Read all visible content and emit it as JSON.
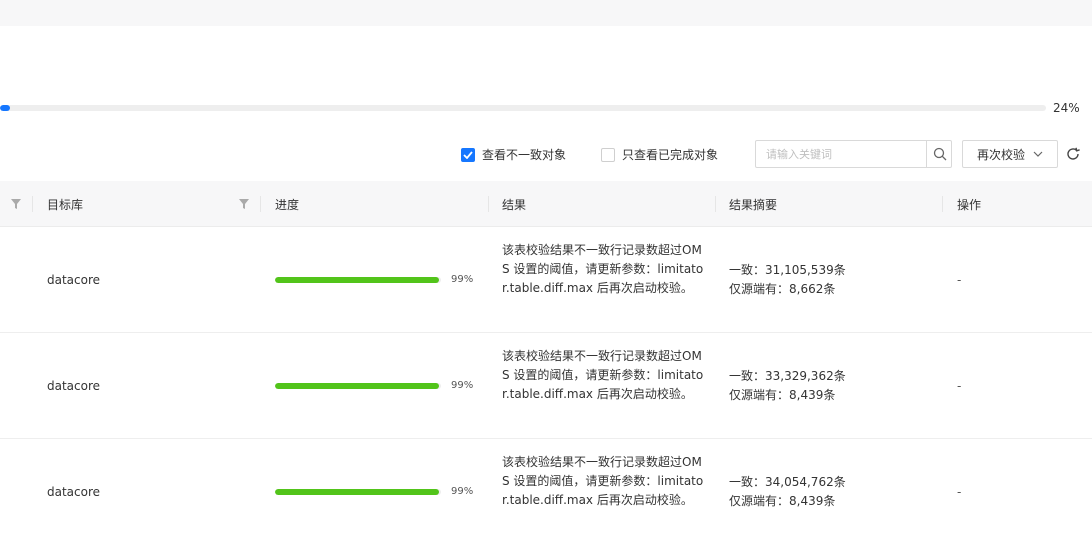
{
  "overall": {
    "percent_label": "24%",
    "progress_fraction": 0.01
  },
  "filters": {
    "inconsistent_label": "查看不一致对象",
    "inconsistent_checked": true,
    "completed_label": "只查看已完成对象",
    "completed_checked": false
  },
  "search": {
    "placeholder": "请输入关键词"
  },
  "toolbar": {
    "recheck_label": "再次校验"
  },
  "table": {
    "headers": {
      "target": "目标库",
      "progress": "进度",
      "result": "结果",
      "summary": "结果摘要",
      "actions": "操作"
    },
    "rows": [
      {
        "target": "datacore",
        "progress_pct": 99,
        "progress_label": "99%",
        "result": "该表校验结果不一致行记录数超过OMS 设置的阈值，请更新参数：limitator.table.diff.max 后再次启动校验。",
        "summary_consistent": "一致：31,105,539条",
        "summary_source_only": "仅源端有：8,662条",
        "action": "-"
      },
      {
        "target": "datacore",
        "progress_pct": 99,
        "progress_label": "99%",
        "result": "该表校验结果不一致行记录数超过OMS 设置的阈值，请更新参数：limitator.table.diff.max 后再次启动校验。",
        "summary_consistent": "一致：33,329,362条",
        "summary_source_only": "仅源端有：8,439条",
        "action": "-"
      },
      {
        "target": "datacore",
        "progress_pct": 99,
        "progress_label": "99%",
        "result": "该表校验结果不一致行记录数超过OMS 设置的阈值，请更新参数：limitator.table.diff.max 后再次启动校验。",
        "summary_consistent": "一致：34,054,762条",
        "summary_source_only": "仅源端有：8,439条",
        "action": "-"
      }
    ]
  },
  "icons": {
    "checkbox_checked": "check-icon",
    "search": "search-icon",
    "dropdown": "chevron-down-icon",
    "refresh": "refresh-icon",
    "filter": "filter-icon"
  },
  "colors": {
    "primary": "#1677ff",
    "success": "#52c41a",
    "header_bg": "#f7f7f8"
  }
}
